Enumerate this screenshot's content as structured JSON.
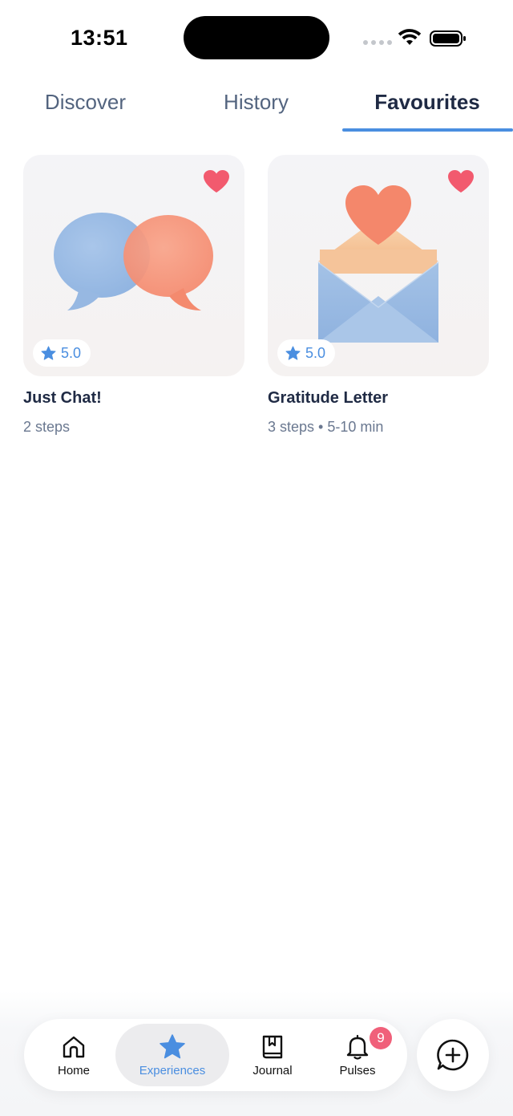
{
  "status_bar": {
    "time": "13:51",
    "icons": [
      "cellular-icon",
      "wifi-icon",
      "battery-icon"
    ]
  },
  "tabs": [
    {
      "label": "Discover",
      "active": false
    },
    {
      "label": "History",
      "active": false
    },
    {
      "label": "Favourites",
      "active": true
    }
  ],
  "cards": [
    {
      "title": "Just Chat!",
      "meta": "2 steps",
      "rating": "5.0",
      "favourite": true,
      "image": "speech-bubbles-illustration"
    },
    {
      "title": "Gratitude Letter",
      "meta": "3 steps • 5-10 min",
      "rating": "5.0",
      "favourite": true,
      "image": "envelope-heart-illustration"
    }
  ],
  "bottom_nav": {
    "items": [
      {
        "label": "Home",
        "icon": "home-icon",
        "active": false
      },
      {
        "label": "Experiences",
        "icon": "star-icon",
        "active": true
      },
      {
        "label": "Journal",
        "icon": "journal-icon",
        "active": false
      },
      {
        "label": "Pulses",
        "icon": "bell-icon",
        "active": false,
        "badge": "9"
      }
    ],
    "fab_icon": "chat-plus-icon"
  },
  "colors": {
    "accent": "#4a8ee0",
    "heart": "#f25a6e",
    "badge": "#f0607a",
    "text_primary": "#1f2a44",
    "text_secondary": "#6a7890"
  }
}
